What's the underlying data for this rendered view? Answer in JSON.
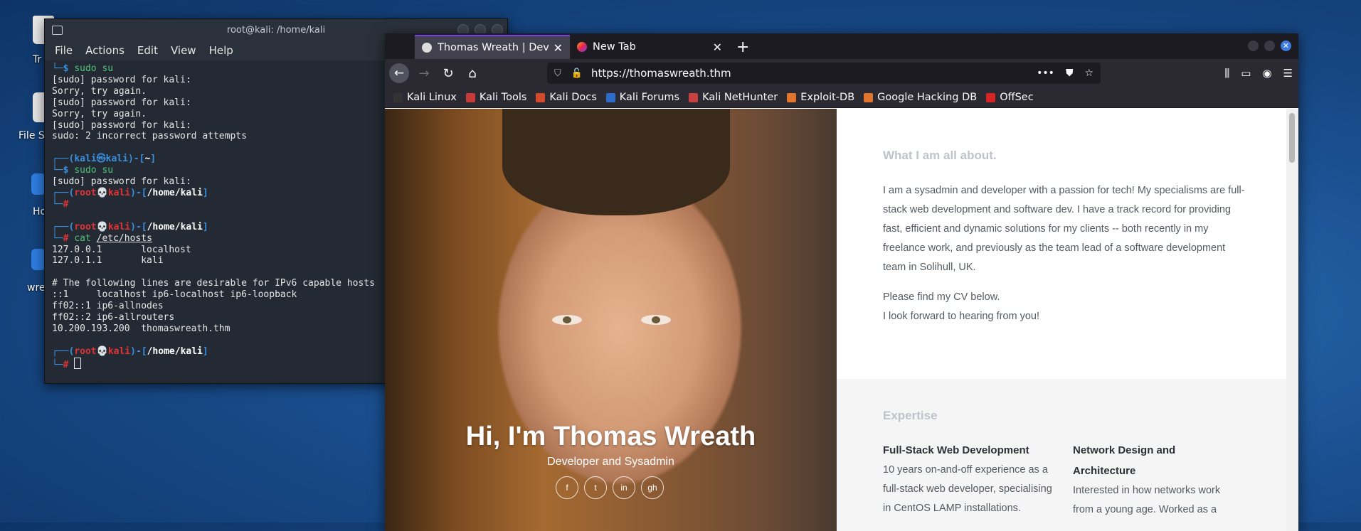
{
  "desktop": {
    "icons": [
      {
        "label": "Tr"
      },
      {
        "label": "File S"
      },
      {
        "label": "Ho"
      },
      {
        "label": "wre"
      }
    ]
  },
  "terminal": {
    "title": "root@kali: /home/kali",
    "menu": [
      "File",
      "Actions",
      "Edit",
      "View",
      "Help"
    ],
    "lines": {
      "l1_cmd": "sudo su",
      "l2": "[sudo] password for kali:",
      "l3": "Sorry, try again.",
      "l4": "[sudo] password for kali:",
      "l5": "Sorry, try again.",
      "l6": "[sudo] password for kali:",
      "l7": "sudo: 2 incorrect password attempts",
      "p1_user": "kali",
      "p1_host": "kali",
      "p1_dir": "~",
      "l9_cmd": "sudo su",
      "l10": "[sudo] password for kali:",
      "p2_user": "root",
      "p2_host": "kali",
      "p2_dir": "/home/kali",
      "p3_user": "root",
      "p3_host": "kali",
      "p3_dir": "/home/kali",
      "cat_cmd": "cat",
      "cat_arg": "/etc/hosts",
      "h1": "127.0.0.1       localhost",
      "h2": "127.0.1.1       kali",
      "h3": "# The following lines are desirable for IPv6 capable hosts",
      "h4": "::1     localhost ip6-localhost ip6-loopback",
      "h5": "ff02::1 ip6-allnodes",
      "h6": "ff02::2 ip6-allrouters",
      "h7": "10.200.193.200  thomaswreath.thm",
      "p4_user": "root",
      "p4_host": "kali",
      "p4_dir": "/home/kali"
    }
  },
  "browser": {
    "tabs": [
      {
        "label": "Thomas Wreath | Developer",
        "active": true
      },
      {
        "label": "New Tab",
        "active": false
      }
    ],
    "new_tab_symbol": "+",
    "url": "https://thomaswreath.thm",
    "bookmarks": [
      {
        "label": "Kali Linux",
        "color": "#3a3a3a"
      },
      {
        "label": "Kali Tools",
        "color": "#d23b3b"
      },
      {
        "label": "Kali Docs",
        "color": "#d24a2a"
      },
      {
        "label": "Kali Forums",
        "color": "#2b6cc9"
      },
      {
        "label": "Kali NetHunter",
        "color": "#c94040"
      },
      {
        "label": "Exploit-DB",
        "color": "#e0752b"
      },
      {
        "label": "Google Hacking DB",
        "color": "#e0752b"
      },
      {
        "label": "OffSec",
        "color": "#d82424"
      }
    ]
  },
  "site": {
    "hero_title": "Hi, I'm Thomas Wreath",
    "hero_subtitle": "Developer and Sysadmin",
    "socials": [
      {
        "icon": "facebook-icon",
        "glyph": "f"
      },
      {
        "icon": "twitter-icon",
        "glyph": "t"
      },
      {
        "icon": "linkedin-icon",
        "glyph": "in"
      },
      {
        "icon": "github-icon",
        "glyph": "gh"
      }
    ],
    "about_heading": "What I am all about.",
    "about_lines": [
      "I am a sysadmin and developer with a passion for tech! My specialisms are full-",
      "stack web development and software dev. I have a track record for providing",
      "fast, efficient and dynamic solutions for my clients -- both recently in my",
      "freelance work, and previously as the team lead of a software development",
      "team in Solihull, UK."
    ],
    "cv_line1": "Please find my CV below.",
    "cv_line2": "I look forward to hearing from you!",
    "expertise_heading": "Expertise",
    "exp1_title": "Full-Stack Web Development",
    "exp1_lines": [
      "10 years on-and-off experience as a",
      "full-stack web developer, specialising",
      "in CentOS LAMP installations."
    ],
    "exp2_title_1": "Network Design and",
    "exp2_title_2": "Architecture",
    "exp2_lines": [
      "Interested in how networks work",
      "from a young age. Worked as a"
    ]
  }
}
